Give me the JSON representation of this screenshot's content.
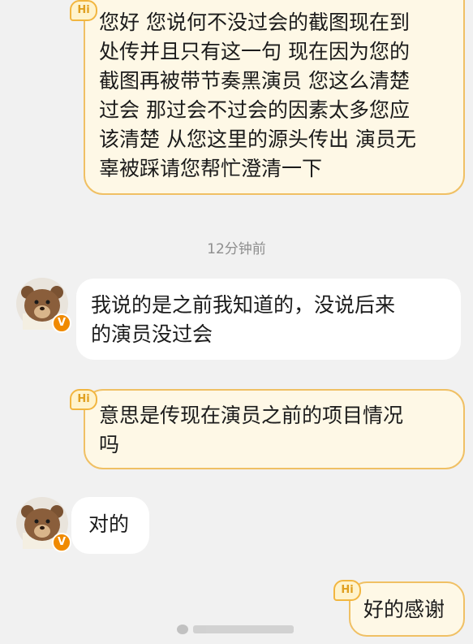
{
  "badges": {
    "hi": "Hi",
    "verified": "V"
  },
  "messages": [
    {
      "side": "out",
      "lines": [
        "您好 您说何不没过会的截图现在到",
        "处传并且只有这一句 现在因为您的",
        "截图再被带节奏黑演员 您这么清楚",
        "过会 那过会不过会的因素太多您应",
        "该清楚 从您这里的源头传出 演员无",
        "辜被踩请您帮忙澄清一下"
      ]
    },
    {
      "side": "in",
      "lines": [
        "我说的是之前我知道的，没说后来",
        "的演员没过会"
      ]
    },
    {
      "side": "out",
      "lines": [
        "意思是传现在演员之前的项目情况",
        "吗"
      ]
    },
    {
      "side": "in",
      "lines": [
        "对的"
      ]
    },
    {
      "side": "out",
      "lines": [
        "好的感谢"
      ]
    }
  ],
  "timestamp": "12分钟前",
  "colors": {
    "background": "#f1f1f1",
    "outgoing_bubble": "#fef8e6",
    "outgoing_border": "#f0c064",
    "incoming_bubble": "#ffffff",
    "verified_badge": "#f08a00"
  },
  "icons": {
    "avatar": "bear-avatar-icon",
    "hi": "hi-badge-icon",
    "verified": "verified-badge-icon",
    "watermark": "weibo-watermark-icon"
  }
}
